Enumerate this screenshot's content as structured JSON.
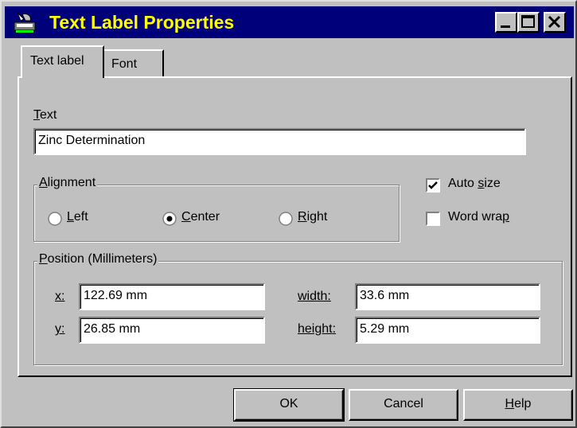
{
  "window": {
    "title": "Text Label Properties",
    "buttons": [
      "minimize",
      "maximize",
      "close"
    ]
  },
  "tabs": [
    {
      "label": "Text label",
      "active": true
    },
    {
      "label": "Font",
      "active": false
    }
  ],
  "text_field": {
    "label": "Text",
    "value": "Zinc Determination"
  },
  "alignment": {
    "caption": "Alignment",
    "options": [
      {
        "label": "Left",
        "selected": false
      },
      {
        "label": "Center",
        "selected": true
      },
      {
        "label": "Right",
        "selected": false
      }
    ]
  },
  "options": {
    "auto_size": {
      "label": "Auto size",
      "checked": true
    },
    "word_wrap": {
      "label": "Word wrap",
      "checked": false
    }
  },
  "position": {
    "caption": "Position (Millimeters)",
    "x_label": "x:",
    "x_value": "122.69 mm",
    "y_label": "y:",
    "y_value": "26.85 mm",
    "width_label": "width:",
    "width_value": "33.6 mm",
    "height_label": "height:",
    "height_value": "5.29 mm"
  },
  "footer_buttons": {
    "ok": "OK",
    "cancel": "Cancel",
    "help": "Help"
  },
  "colors": {
    "title_bar": "#00007b",
    "title_text": "#ffff00",
    "face": "#c0c0c0"
  }
}
